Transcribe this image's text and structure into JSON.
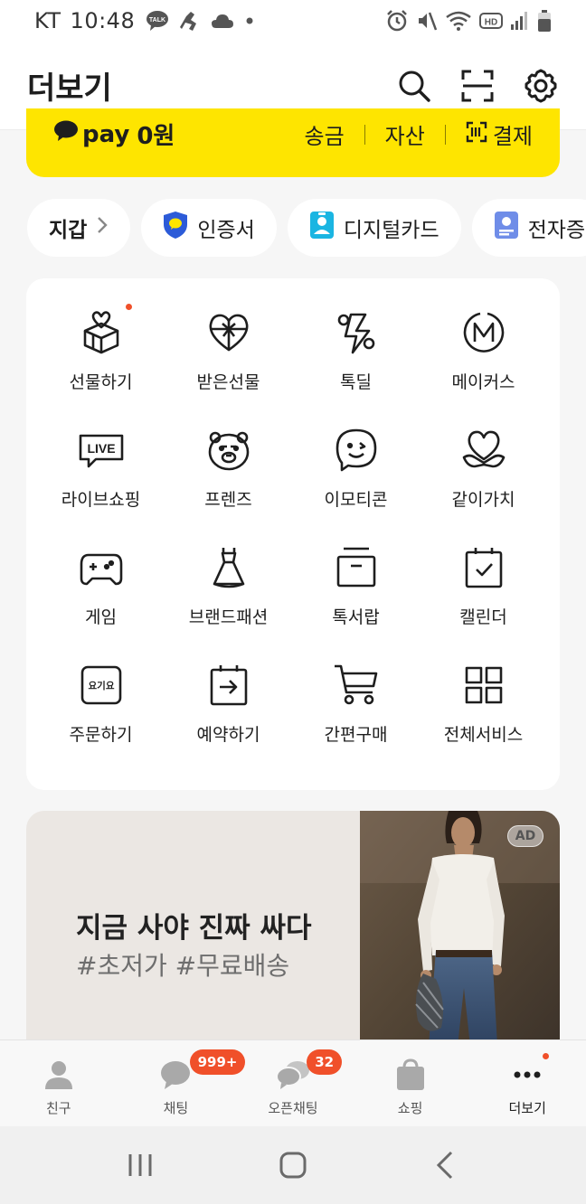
{
  "status_bar": {
    "carrier": "KT",
    "time": "10:48",
    "left_icons": [
      "talk-icon",
      "runner-icon",
      "cloud-icon",
      "dot-icon"
    ],
    "right_icons": [
      "alarm-icon",
      "mute-icon",
      "wifi-icon",
      "hd-icon",
      "signal-icon",
      "battery-icon"
    ],
    "hd_text": "HD"
  },
  "header": {
    "title": "더보기",
    "icons": [
      "search-icon",
      "scan-icon",
      "settings-icon"
    ]
  },
  "pay": {
    "logo_text": "pay",
    "amount": "0원",
    "actions": [
      "송금",
      "자산",
      "결제"
    ],
    "color": "#fee500"
  },
  "chips": [
    {
      "label": "지갑",
      "icon": "chevron-right-icon"
    },
    {
      "label": "인증서",
      "icon": "shield-icon"
    },
    {
      "label": "디지털카드",
      "icon": "id-card-icon"
    },
    {
      "label": "전자증",
      "icon": "document-icon"
    }
  ],
  "services": [
    {
      "label": "선물하기",
      "icon": "gift-icon",
      "has_dot": true
    },
    {
      "label": "받은선물",
      "icon": "received-gift-icon"
    },
    {
      "label": "톡딜",
      "icon": "talkdeal-icon"
    },
    {
      "label": "메이커스",
      "icon": "makers-icon"
    },
    {
      "label": "라이브쇼핑",
      "icon": "live-icon",
      "icon_text": "LIVE"
    },
    {
      "label": "프렌즈",
      "icon": "friends-bear-icon"
    },
    {
      "label": "이모티콘",
      "icon": "emoticon-icon"
    },
    {
      "label": "같이가치",
      "icon": "heart-hands-icon"
    },
    {
      "label": "게임",
      "icon": "gamepad-icon"
    },
    {
      "label": "브랜드패션",
      "icon": "dress-icon"
    },
    {
      "label": "톡서랍",
      "icon": "drawer-icon"
    },
    {
      "label": "캘린더",
      "icon": "calendar-icon"
    },
    {
      "label": "주문하기",
      "icon": "order-icon",
      "icon_text": "요기요"
    },
    {
      "label": "예약하기",
      "icon": "reservation-icon"
    },
    {
      "label": "간편구매",
      "icon": "cart-icon"
    },
    {
      "label": "전체서비스",
      "icon": "all-services-icon"
    }
  ],
  "ad": {
    "headline": "지금 사야 진짜 싸다",
    "subline": "#초저가 #무료배송",
    "badge": "AD"
  },
  "tabs": [
    {
      "label": "친구",
      "icon": "friends-icon"
    },
    {
      "label": "채팅",
      "icon": "chat-icon",
      "badge": "999+"
    },
    {
      "label": "오픈채팅",
      "icon": "open-chat-icon",
      "badge": "32"
    },
    {
      "label": "쇼핑",
      "icon": "shopping-bag-icon"
    },
    {
      "label": "더보기",
      "icon": "more-icon",
      "active": true,
      "has_dot": true
    }
  ],
  "nav": [
    "recent-apps-icon",
    "home-icon",
    "back-icon"
  ],
  "colors": {
    "accent": "#fee500",
    "badge": "#f0502a",
    "text": "#1e1e1e"
  }
}
